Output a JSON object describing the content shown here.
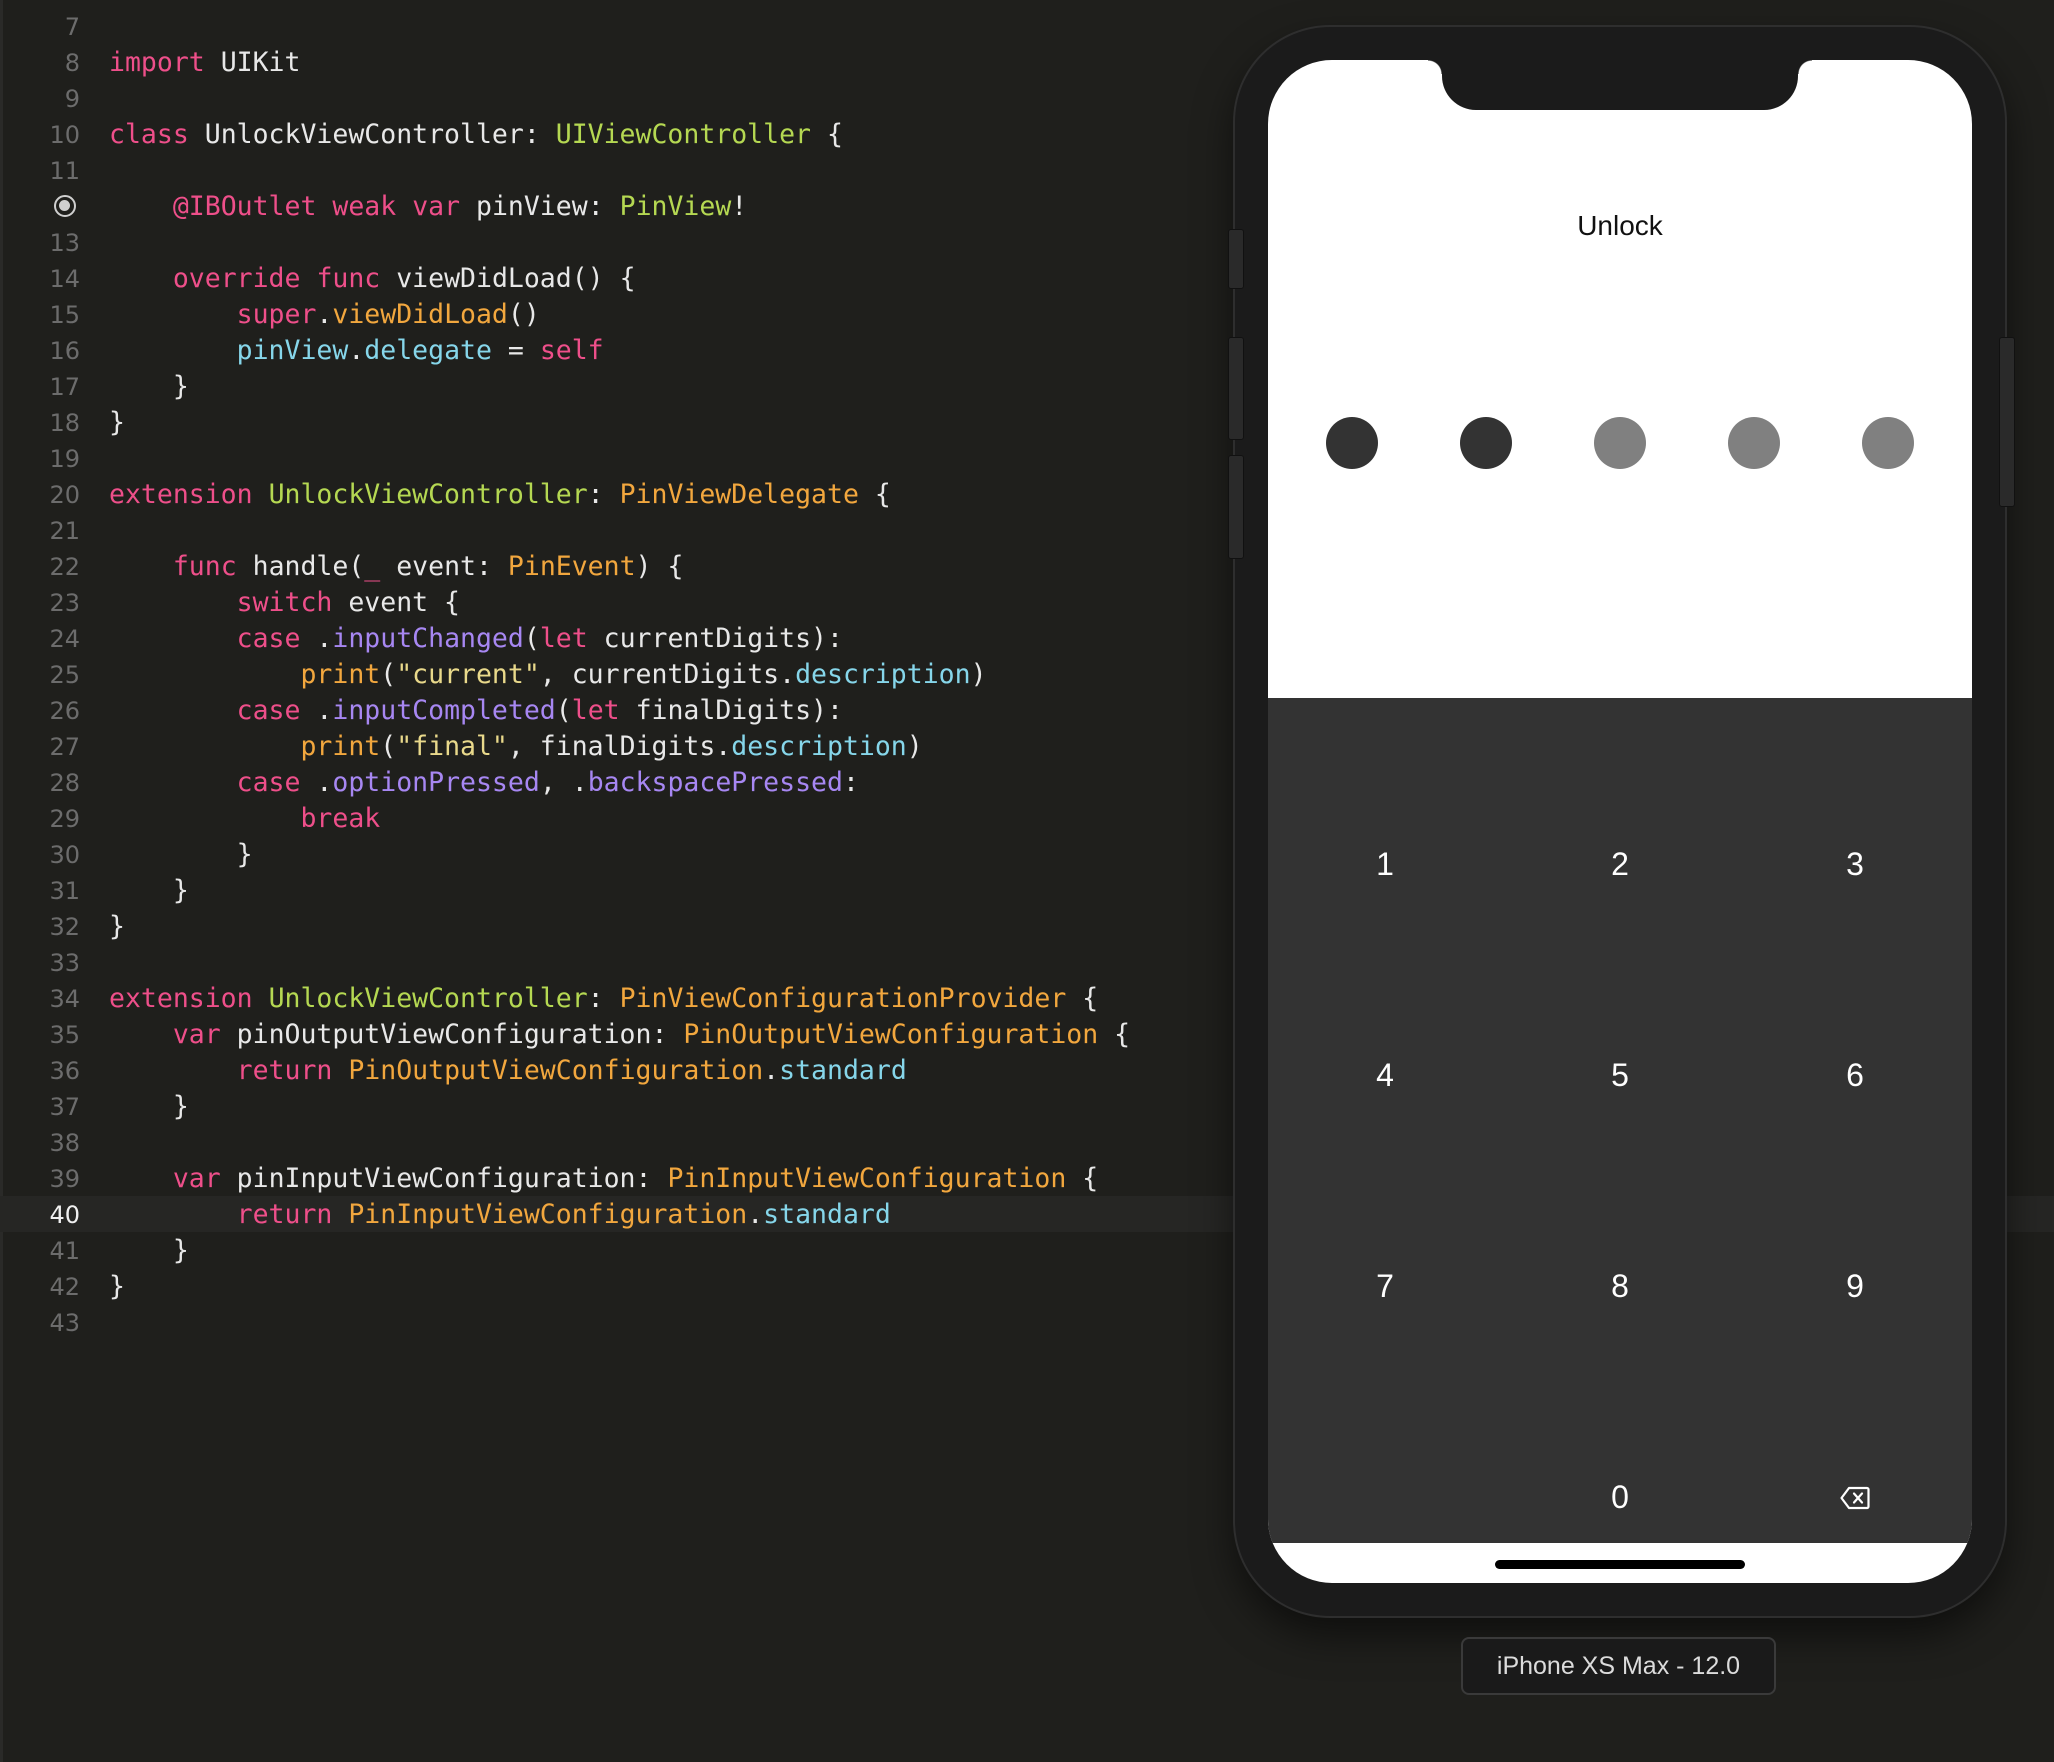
{
  "editor": {
    "current_line": 40,
    "outlet_line": 12,
    "lines": [
      {
        "n": "7",
        "tokens": []
      },
      {
        "n": "8",
        "tokens": [
          [
            "kw",
            "import"
          ],
          [
            "plain",
            " UIKit"
          ]
        ]
      },
      {
        "n": "9",
        "tokens": []
      },
      {
        "n": "10",
        "tokens": [
          [
            "kw",
            "class"
          ],
          [
            "plain",
            " UnlockViewController: "
          ],
          [
            "type",
            "UIViewController"
          ],
          [
            "plain",
            " {"
          ]
        ]
      },
      {
        "n": "11",
        "tokens": []
      },
      {
        "n": "12",
        "tokens": [
          [
            "plain",
            "    "
          ],
          [
            "kw",
            "@IBOutlet"
          ],
          [
            "plain",
            " "
          ],
          [
            "kw",
            "weak"
          ],
          [
            "plain",
            " "
          ],
          [
            "kw",
            "var"
          ],
          [
            "plain",
            " pinView: "
          ],
          [
            "type",
            "PinView"
          ],
          [
            "plain",
            "!"
          ]
        ]
      },
      {
        "n": "13",
        "tokens": []
      },
      {
        "n": "14",
        "tokens": [
          [
            "plain",
            "    "
          ],
          [
            "kw",
            "override"
          ],
          [
            "plain",
            " "
          ],
          [
            "kw",
            "func"
          ],
          [
            "plain",
            " viewDidLoad() {"
          ]
        ]
      },
      {
        "n": "15",
        "tokens": [
          [
            "plain",
            "        "
          ],
          [
            "kw",
            "super"
          ],
          [
            "plain",
            "."
          ],
          [
            "fn",
            "viewDidLoad"
          ],
          [
            "plain",
            "()"
          ]
        ]
      },
      {
        "n": "16",
        "tokens": [
          [
            "plain",
            "        "
          ],
          [
            "prop",
            "pinView"
          ],
          [
            "plain",
            "."
          ],
          [
            "prop",
            "delegate"
          ],
          [
            "plain",
            " = "
          ],
          [
            "kw",
            "self"
          ]
        ]
      },
      {
        "n": "17",
        "tokens": [
          [
            "plain",
            "    }"
          ]
        ]
      },
      {
        "n": "18",
        "tokens": [
          [
            "plain",
            "}"
          ]
        ]
      },
      {
        "n": "19",
        "tokens": []
      },
      {
        "n": "20",
        "tokens": [
          [
            "kw",
            "extension"
          ],
          [
            "plain",
            " "
          ],
          [
            "type",
            "UnlockViewController"
          ],
          [
            "plain",
            ": "
          ],
          [
            "otype",
            "PinViewDelegate"
          ],
          [
            "plain",
            " {"
          ]
        ]
      },
      {
        "n": "21",
        "tokens": []
      },
      {
        "n": "22",
        "tokens": [
          [
            "plain",
            "    "
          ],
          [
            "kw",
            "func"
          ],
          [
            "plain",
            " handle("
          ],
          [
            "kw",
            "_"
          ],
          [
            "plain",
            " event: "
          ],
          [
            "otype",
            "PinEvent"
          ],
          [
            "plain",
            ") {"
          ]
        ]
      },
      {
        "n": "23",
        "tokens": [
          [
            "plain",
            "        "
          ],
          [
            "kw",
            "switch"
          ],
          [
            "plain",
            " event {"
          ]
        ]
      },
      {
        "n": "24",
        "tokens": [
          [
            "plain",
            "        "
          ],
          [
            "kw",
            "case"
          ],
          [
            "plain",
            " ."
          ],
          [
            "enum",
            "inputChanged"
          ],
          [
            "plain",
            "("
          ],
          [
            "kw",
            "let"
          ],
          [
            "plain",
            " currentDigits):"
          ]
        ]
      },
      {
        "n": "25",
        "tokens": [
          [
            "plain",
            "            "
          ],
          [
            "fn",
            "print"
          ],
          [
            "plain",
            "("
          ],
          [
            "str",
            "\"current\""
          ],
          [
            "plain",
            ", currentDigits."
          ],
          [
            "prop",
            "description"
          ],
          [
            "plain",
            ")"
          ]
        ]
      },
      {
        "n": "26",
        "tokens": [
          [
            "plain",
            "        "
          ],
          [
            "kw",
            "case"
          ],
          [
            "plain",
            " ."
          ],
          [
            "enum",
            "inputCompleted"
          ],
          [
            "plain",
            "("
          ],
          [
            "kw",
            "let"
          ],
          [
            "plain",
            " finalDigits):"
          ]
        ]
      },
      {
        "n": "27",
        "tokens": [
          [
            "plain",
            "            "
          ],
          [
            "fn",
            "print"
          ],
          [
            "plain",
            "("
          ],
          [
            "str",
            "\"final\""
          ],
          [
            "plain",
            ", finalDigits."
          ],
          [
            "prop",
            "description"
          ],
          [
            "plain",
            ")"
          ]
        ]
      },
      {
        "n": "28",
        "tokens": [
          [
            "plain",
            "        "
          ],
          [
            "kw",
            "case"
          ],
          [
            "plain",
            " ."
          ],
          [
            "enum",
            "optionPressed"
          ],
          [
            "plain",
            ", ."
          ],
          [
            "enum",
            "backspacePressed"
          ],
          [
            "plain",
            ":"
          ]
        ]
      },
      {
        "n": "29",
        "tokens": [
          [
            "plain",
            "            "
          ],
          [
            "kw",
            "break"
          ]
        ]
      },
      {
        "n": "30",
        "tokens": [
          [
            "plain",
            "        }"
          ]
        ]
      },
      {
        "n": "31",
        "tokens": [
          [
            "plain",
            "    }"
          ]
        ]
      },
      {
        "n": "32",
        "tokens": [
          [
            "plain",
            "}"
          ]
        ]
      },
      {
        "n": "33",
        "tokens": []
      },
      {
        "n": "34",
        "tokens": [
          [
            "kw",
            "extension"
          ],
          [
            "plain",
            " "
          ],
          [
            "type",
            "UnlockViewController"
          ],
          [
            "plain",
            ": "
          ],
          [
            "otype",
            "PinViewConfigurationProvider"
          ],
          [
            "plain",
            " {"
          ]
        ]
      },
      {
        "n": "35",
        "tokens": [
          [
            "plain",
            "    "
          ],
          [
            "kw",
            "var"
          ],
          [
            "plain",
            " pinOutputViewConfiguration: "
          ],
          [
            "otype",
            "PinOutputViewConfiguration"
          ],
          [
            "plain",
            " {"
          ]
        ]
      },
      {
        "n": "36",
        "tokens": [
          [
            "plain",
            "        "
          ],
          [
            "kw",
            "return"
          ],
          [
            "plain",
            " "
          ],
          [
            "otype",
            "PinOutputViewConfiguration"
          ],
          [
            "plain",
            "."
          ],
          [
            "prop",
            "standard"
          ]
        ]
      },
      {
        "n": "37",
        "tokens": [
          [
            "plain",
            "    }"
          ]
        ]
      },
      {
        "n": "38",
        "tokens": []
      },
      {
        "n": "39",
        "tokens": [
          [
            "plain",
            "    "
          ],
          [
            "kw",
            "var"
          ],
          [
            "plain",
            " pinInputViewConfiguration: "
          ],
          [
            "otype",
            "PinInputViewConfiguration"
          ],
          [
            "plain",
            " {"
          ]
        ]
      },
      {
        "n": "40",
        "tokens": [
          [
            "plain",
            "        "
          ],
          [
            "kw",
            "return"
          ],
          [
            "plain",
            " "
          ],
          [
            "otype",
            "PinInputViewConfiguration"
          ],
          [
            "plain",
            "."
          ],
          [
            "prop",
            "standard"
          ]
        ]
      },
      {
        "n": "41",
        "tokens": [
          [
            "plain",
            "    }"
          ]
        ]
      },
      {
        "n": "42",
        "tokens": [
          [
            "plain",
            "}"
          ]
        ]
      },
      {
        "n": "43",
        "tokens": []
      }
    ]
  },
  "simulator": {
    "title": "Unlock",
    "pin": {
      "length": 5,
      "entered": 2,
      "filled_color": "#333333",
      "empty_color": "#808080"
    },
    "keypad": {
      "keys": [
        "1",
        "2",
        "3",
        "4",
        "5",
        "6",
        "7",
        "8",
        "9",
        "",
        "0",
        "backspace"
      ],
      "backspace_icon": "delete-left-icon"
    },
    "device_label": "iPhone XS Max - 12.0"
  }
}
